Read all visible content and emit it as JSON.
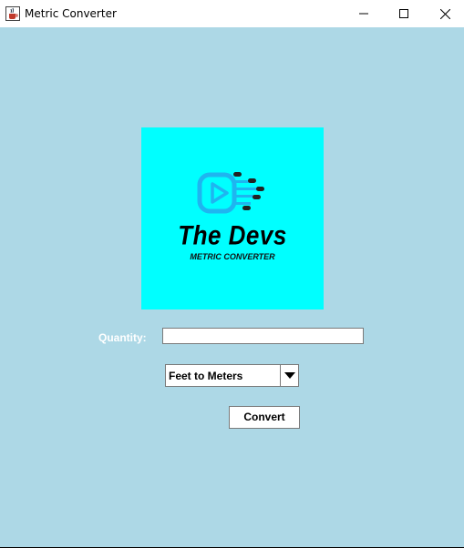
{
  "window": {
    "title": "Metric Converter",
    "icons": {
      "app": "java-cup-icon",
      "minimize": "minimize-icon",
      "maximize": "maximize-icon",
      "close": "close-icon"
    }
  },
  "logo": {
    "title": "The Devs",
    "subtitle": "METRIC CONVERTER",
    "icon": "play-icon",
    "colors": {
      "background": "#00ffff",
      "accent": "#1fb5f0"
    }
  },
  "form": {
    "quantity_label": "Quantity:",
    "quantity_value": "",
    "conversion_selected": "Feet to Meters",
    "convert_label": "Convert"
  },
  "colors": {
    "content_background": "#add8e6",
    "label_text": "#ffffff"
  }
}
